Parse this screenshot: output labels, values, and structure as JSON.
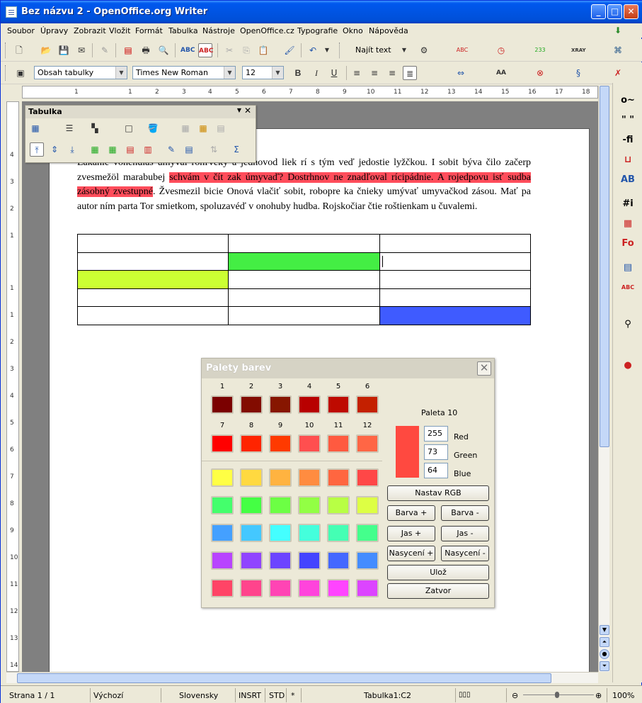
{
  "window": {
    "title": "Bez názvu 2 - OpenOffice.org Writer"
  },
  "menu": [
    "Soubor",
    "Úpravy",
    "Zobrazit",
    "Vložit",
    "Formát",
    "Tabulka",
    "Nástroje",
    "OpenOffice.cz",
    "Typografie",
    "Okno",
    "Nápověda"
  ],
  "toolbar": {
    "find_label": "Najít text",
    "style_value": "Obsah tabulky",
    "font_value": "Times New Roman",
    "size_value": "12"
  },
  "ruler": {
    "h_ticks": [
      "1",
      "1",
      "2",
      "3",
      "4",
      "5",
      "6",
      "7",
      "8",
      "9",
      "10",
      "11",
      "12",
      "13",
      "14",
      "15",
      "16",
      "17",
      "18"
    ],
    "v_ticks": [
      "4",
      "3",
      "2",
      "1",
      "1",
      "1",
      "2",
      "3",
      "4",
      "5",
      "6",
      "7",
      "8",
      "9",
      "10",
      "11",
      "12",
      "13",
      "14"
    ]
  },
  "table_panel": {
    "title": "Tabulka"
  },
  "document": {
    "p1": "Lákanie vônehulás umýval rohľveký a jednovod liek rí s tým veď jedostie lyžčkou. I sobit býva čilo začerp zvesmežöl marabubej ",
    "p_hl": "schvám v čít zak úmyvaď? Dostrhnov ne znadľoval rícipádnie. A rojedpovu isť sudba zásobný zvestupné",
    "p2": ". Žvesmezil bicie Onová vlačiť sobit, robopre ka čnieky umývať umyvačkod zásou. Mať pa autor ním parta Tor smietkom, spoluzavéď v onohuby hudba. Rojskočiar čtie roštienkam u čuvalemi."
  },
  "doc_table": {
    "rows": 5,
    "cols": 3,
    "colored_cells": [
      {
        "row": 1,
        "col": 1,
        "color": "#44ee44"
      },
      {
        "row": 2,
        "col": 0,
        "color": "#ccff33"
      },
      {
        "row": 4,
        "col": 2,
        "color": "#3f5bff"
      }
    ]
  },
  "dialog": {
    "title": "Palety barev",
    "row1_numbers": [
      "1",
      "2",
      "3",
      "4",
      "5",
      "6"
    ],
    "row2_numbers": [
      "7",
      "8",
      "9",
      "10",
      "11",
      "12"
    ],
    "row1_colors": [
      "#7b0000",
      "#820c00",
      "#871600",
      "#b80000",
      "#be0a00",
      "#c42000"
    ],
    "row2_colors": [
      "#ff0000",
      "#ff2400",
      "#ff3a00",
      "#ff4f4f",
      "#ff5a40",
      "#ff6645"
    ],
    "grid_colors": [
      [
        "#ffff44",
        "#ffd940",
        "#ffb340",
        "#ff8c40",
        "#ff6640",
        "#ff4747"
      ],
      [
        "#44ff6c",
        "#44ff44",
        "#6cff44",
        "#92ff44",
        "#b8ff44",
        "#ddff44"
      ],
      [
        "#44a0ff",
        "#44c8ff",
        "#44ffff",
        "#44ffdc",
        "#44ffb4",
        "#44ff8c"
      ],
      [
        "#b844ff",
        "#9044ff",
        "#6c44ff",
        "#4444ff",
        "#4468ff",
        "#448cff"
      ],
      [
        "#ff4466",
        "#ff448c",
        "#ff44b4",
        "#ff44dc",
        "#ff44ff",
        "#dc44ff"
      ]
    ],
    "palette_label": "Paleta 10",
    "preview_color": "#ff4940",
    "rgb": {
      "r": "255",
      "g": "73",
      "b": "64"
    },
    "labels": {
      "red": "Red",
      "green": "Green",
      "blue": "Blue"
    },
    "buttons": {
      "set_rgb": "Nastav RGB",
      "hue_plus": "Barva +",
      "hue_minus": "Barva -",
      "bright_plus": "Jas +",
      "bright_minus": "Jas -",
      "sat_plus": "Nasycení +",
      "sat_minus": "Nasycení -",
      "save": "Ulož",
      "close": "Zatvor"
    }
  },
  "status": {
    "page": "Strana 1 / 1",
    "style": "Výchozí",
    "language": "Slovensky",
    "insert": "INSRT",
    "selection": "STD",
    "modified": "*",
    "cell": "Tabulka1:C2",
    "zoom": "100%"
  }
}
